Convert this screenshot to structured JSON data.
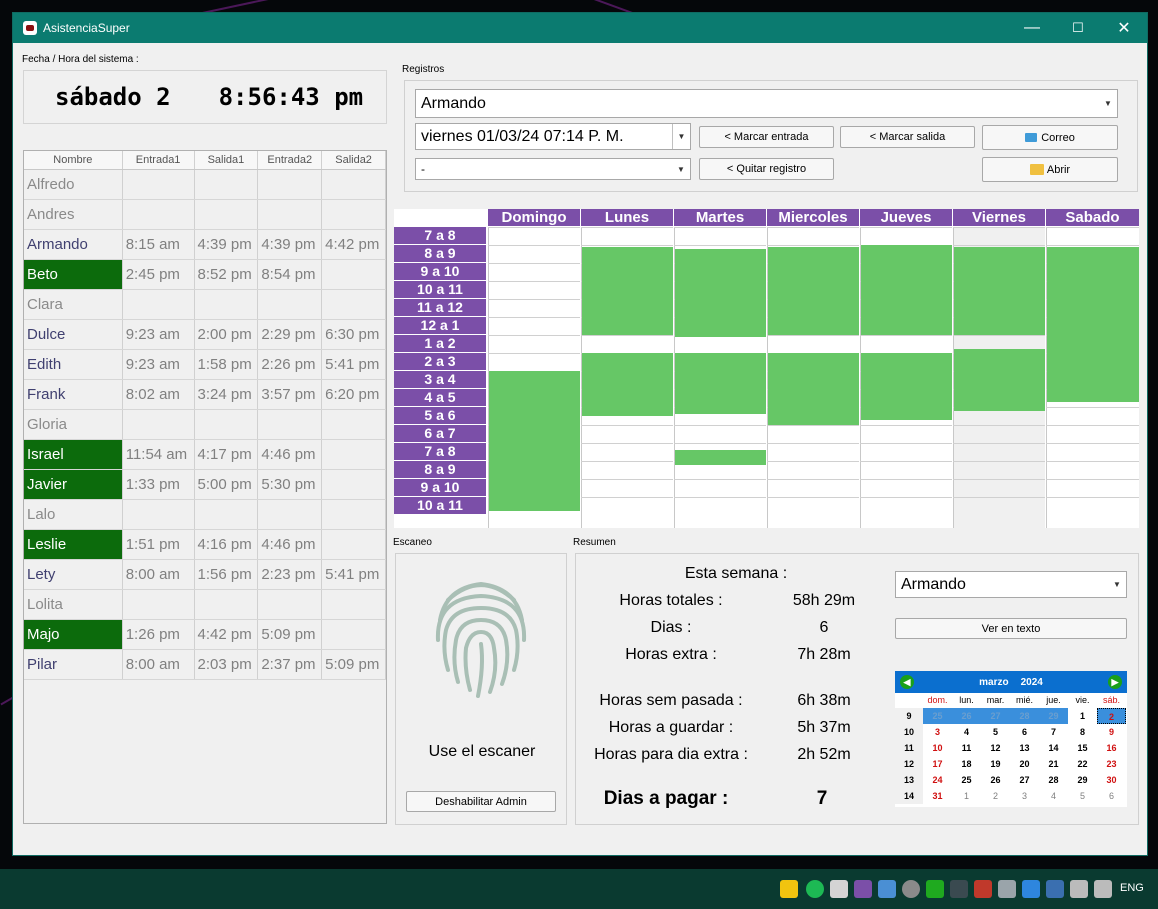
{
  "window": {
    "title": "AsistenciaSuper",
    "min": "—",
    "max": "☐",
    "close": "✕"
  },
  "clock": {
    "label": "Fecha / Hora del sistema :",
    "day": "sábado 2",
    "time": "8:56:43 pm"
  },
  "table": {
    "headers": [
      "Nombre",
      "Entrada1",
      "Salida1",
      "Entrada2",
      "Salida2"
    ],
    "rows": [
      {
        "name": "Alfredo",
        "e1": "",
        "s1": "",
        "e2": "",
        "s2": "",
        "state": "off"
      },
      {
        "name": "Andres",
        "e1": "",
        "s1": "",
        "e2": "",
        "s2": "",
        "state": "off"
      },
      {
        "name": "Armando",
        "e1": "8:15 am",
        "s1": "4:39 pm",
        "e2": "4:39 pm",
        "s2": "4:42 pm",
        "state": "done"
      },
      {
        "name": "Beto",
        "e1": "2:45 pm",
        "s1": "8:52 pm",
        "e2": "8:54 pm",
        "s2": "",
        "state": "in"
      },
      {
        "name": "Clara",
        "e1": "",
        "s1": "",
        "e2": "",
        "s2": "",
        "state": "off"
      },
      {
        "name": "Dulce",
        "e1": "9:23 am",
        "s1": "2:00 pm",
        "e2": "2:29 pm",
        "s2": "6:30 pm",
        "state": "done"
      },
      {
        "name": "Edith",
        "e1": "9:23 am",
        "s1": "1:58 pm",
        "e2": "2:26 pm",
        "s2": "5:41 pm",
        "state": "done"
      },
      {
        "name": "Frank",
        "e1": "8:02 am",
        "s1": "3:24 pm",
        "e2": "3:57 pm",
        "s2": "6:20 pm",
        "state": "done"
      },
      {
        "name": "Gloria",
        "e1": "",
        "s1": "",
        "e2": "",
        "s2": "",
        "state": "off"
      },
      {
        "name": "Israel",
        "e1": "11:54 am",
        "s1": "4:17 pm",
        "e2": "4:46 pm",
        "s2": "",
        "state": "in"
      },
      {
        "name": "Javier",
        "e1": "1:33 pm",
        "s1": "5:00 pm",
        "e2": "5:30 pm",
        "s2": "",
        "state": "in"
      },
      {
        "name": "Lalo",
        "e1": "",
        "s1": "",
        "e2": "",
        "s2": "",
        "state": "off"
      },
      {
        "name": "Leslie",
        "e1": "1:51 pm",
        "s1": "4:16 pm",
        "e2": "4:46 pm",
        "s2": "",
        "state": "in"
      },
      {
        "name": "Lety",
        "e1": "8:00 am",
        "s1": "1:56 pm",
        "e2": "2:23 pm",
        "s2": "5:41 pm",
        "state": "done"
      },
      {
        "name": "Lolita",
        "e1": "",
        "s1": "",
        "e2": "",
        "s2": "",
        "state": "off"
      },
      {
        "name": "Majo",
        "e1": "1:26 pm",
        "s1": "4:42 pm",
        "e2": "5:09 pm",
        "s2": "",
        "state": "in"
      },
      {
        "name": "Pilar",
        "e1": "8:00 am",
        "s1": "2:03 pm",
        "e2": "2:37 pm",
        "s2": "5:09 pm",
        "state": "done"
      }
    ]
  },
  "registros": {
    "label": "Registros",
    "employee": "Armando",
    "datetime": "viernes 01/03/24 07:14 P. M.",
    "record": "-",
    "btn_entrada": "< Marcar entrada",
    "btn_salida": "< Marcar salida",
    "btn_correo": "Correo",
    "btn_quitar": "< Quitar registro",
    "btn_abrir": "Abrir"
  },
  "schedule": {
    "days": [
      "Domingo",
      "Lunes",
      "Martes",
      "Miercoles",
      "Jueves",
      "Viernes",
      "Sabado"
    ],
    "hours": [
      "7 a 8",
      "8 a 9",
      "9 a 10",
      "10 a 11",
      "11 a 12",
      "12 a 1",
      "1 a 2",
      "2 a 3",
      "3 a 4",
      "4 a 5",
      "5 a 6",
      "6 a 7",
      "7 a 8",
      "8 a 9",
      "9 a 10",
      "10 a 11"
    ],
    "worked": [
      [
        [
          8.0,
          15.8
        ]
      ],
      [
        [
          1.1,
          6.0
        ],
        [
          7.0,
          10.5
        ]
      ],
      [
        [
          1.2,
          6.1
        ],
        [
          7.0,
          10.4
        ],
        [
          12.4,
          13.2
        ]
      ],
      [
        [
          1.1,
          6.0
        ],
        [
          7.0,
          11.0
        ]
      ],
      [
        [
          1.0,
          6.0
        ],
        [
          7.0,
          10.7
        ]
      ],
      [
        [
          1.1,
          6.0
        ],
        [
          6.8,
          10.2
        ]
      ],
      [
        [
          1.1,
          9.7
        ]
      ]
    ],
    "shaded_day": "Viernes"
  },
  "escaneo": {
    "label": "Escaneo",
    "prompt": "Use el escaner",
    "btn_admin": "Deshabilitar Admin"
  },
  "resumen": {
    "label": "Resumen",
    "heading": "Esta semana :",
    "rows": [
      {
        "k": "Horas totales :",
        "v": "58h 29m"
      },
      {
        "k": "Dias :",
        "v": "6"
      },
      {
        "k": "Horas extra :",
        "v": "7h 28m"
      },
      {
        "k": "Horas sem pasada :",
        "v": "6h 38m"
      },
      {
        "k": "Horas a guardar :",
        "v": "5h 37m"
      },
      {
        "k": "Horas para dia extra :",
        "v": "2h 52m"
      }
    ],
    "pay_label": "Dias a pagar :",
    "pay_value": "7",
    "employee": "Armando",
    "btn_text": "Ver en texto"
  },
  "calendar": {
    "month": "marzo",
    "year": "2024",
    "dows": [
      "dom.",
      "lun.",
      "mar.",
      "mié.",
      "jue.",
      "vie.",
      "sáb."
    ],
    "weeks": [
      {
        "wk": "9",
        "d": [
          "25",
          "26",
          "27",
          "28",
          "29",
          "1",
          "2"
        ]
      },
      {
        "wk": "10",
        "d": [
          "3",
          "4",
          "5",
          "6",
          "7",
          "8",
          "9"
        ]
      },
      {
        "wk": "11",
        "d": [
          "10",
          "11",
          "12",
          "13",
          "14",
          "15",
          "16"
        ]
      },
      {
        "wk": "12",
        "d": [
          "17",
          "18",
          "19",
          "20",
          "21",
          "22",
          "23"
        ]
      },
      {
        "wk": "13",
        "d": [
          "24",
          "25",
          "26",
          "27",
          "28",
          "29",
          "30"
        ]
      },
      {
        "wk": "14",
        "d": [
          "31",
          "1",
          "2",
          "3",
          "4",
          "5",
          "6"
        ]
      }
    ]
  },
  "taskbar": {
    "lang": "ENG"
  }
}
